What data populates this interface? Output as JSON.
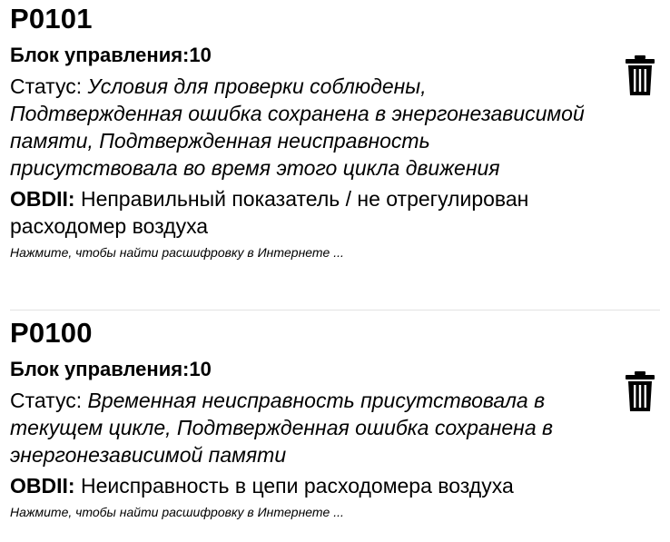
{
  "errors": [
    {
      "code": "P0101",
      "module": "Блок управления:10",
      "status_label": "Статус:",
      "status_value": "Условия для проверки соблюдены, Подтвержденная ошибка сохранена в энергонезависимой памяти, Подтвержденная неисправность присутствовала во время этого цикла движения",
      "obd_label": "OBDII:",
      "obd_value": "Неправильный показатель / не отрегулирован расходомер воздуха",
      "hint": "Нажмите, чтобы найти расшифровку в Интернете ...",
      "delete_icon": "trash-icon"
    },
    {
      "code": "P0100",
      "module": "Блок управления:10",
      "status_label": "Статус:",
      "status_value": "Временная неисправность присутствовала в текущем цикле, Подтвержденная ошибка сохранена в энергонезависимой памяти",
      "obd_label": "OBDII:",
      "obd_value": "Неисправность в цепи расходомера воздуха",
      "hint": "Нажмите, чтобы найти расшифровку в Интернете ...",
      "delete_icon": "trash-icon"
    }
  ],
  "colors": {
    "text": "#000000",
    "divider": "#e2e2e2",
    "background": "#ffffff"
  }
}
